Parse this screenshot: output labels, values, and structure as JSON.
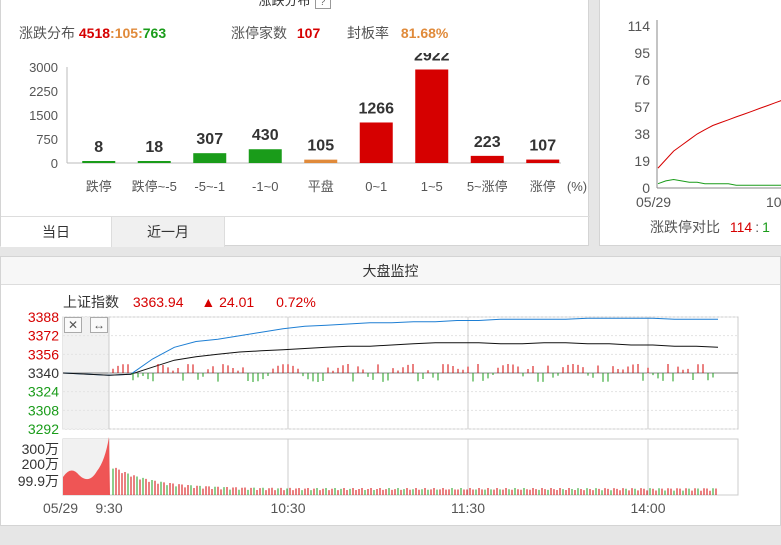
{
  "distribution": {
    "title": "涨跌分布",
    "help_icon": "?",
    "up_down_label": "涨跌分布",
    "up_count": "4518",
    "sep": ":",
    "flat_count": "105",
    "down_count": "763",
    "limit_up_label": "涨停家数",
    "limit_up_count": "107",
    "seal_rate_label": "封板率",
    "seal_rate": "81.68%",
    "unit": "(%)"
  },
  "tabs": {
    "today": "当日",
    "month": "近一月"
  },
  "chart_data": [
    {
      "type": "bar",
      "categories": [
        "跌停",
        "跌停~-5",
        "-5~-1",
        "-1~0",
        "平盘",
        "0~1",
        "1~5",
        "5~涨停",
        "涨停"
      ],
      "values": [
        8,
        18,
        307,
        430,
        105,
        1266,
        2922,
        223,
        107
      ],
      "colors": [
        "#1a9c1a",
        "#1a9c1a",
        "#1a9c1a",
        "#1a9c1a",
        "#e08a3a",
        "#d60000",
        "#d60000",
        "#d60000",
        "#d60000"
      ],
      "yticks": [
        "3000",
        "2250",
        "1500",
        "750",
        "0"
      ],
      "ylim": [
        0,
        3000
      ],
      "xlabel": "(%)"
    },
    {
      "type": "line",
      "yticks": [
        "114",
        "95",
        "76",
        "57",
        "38",
        "19",
        "0"
      ],
      "ylim": [
        0,
        114
      ],
      "xticks": [
        "05/29",
        "10"
      ],
      "series": [
        {
          "color": "#d60000",
          "values": [
            14,
            20,
            26,
            30,
            34,
            38,
            41,
            44,
            46,
            48,
            50,
            52,
            54,
            56,
            58,
            60,
            62,
            64
          ]
        },
        {
          "color": "#1a9c1a",
          "values": [
            3,
            5,
            6,
            5,
            4,
            4,
            3,
            3,
            3,
            3,
            2,
            2,
            2,
            2,
            2,
            2,
            2,
            2
          ]
        }
      ],
      "legend_label": "涨跌停对比",
      "legend_up": "114",
      "legend_sep": ":",
      "legend_down": "1"
    },
    {
      "type": "line",
      "yticks": [
        "3388",
        "3372",
        "3356",
        "3340",
        "3324",
        "3308",
        "3292"
      ],
      "ylim": [
        3292,
        3388
      ],
      "xticks": [
        "05/29",
        "9:30",
        "10:30",
        "11:30",
        "14:00"
      ],
      "series": [
        {
          "color": "#1e7fd4",
          "values": [
            3340,
            3338,
            3339,
            3352,
            3362,
            3367,
            3369,
            3372,
            3375,
            3378,
            3380,
            3381,
            3382,
            3383,
            3383,
            3384,
            3384,
            3385,
            3385,
            3386,
            3386,
            3386,
            3386,
            3387,
            3387,
            3387,
            3387,
            3386,
            3386,
            3386
          ]
        },
        {
          "color": "#111111",
          "values": [
            3340,
            3338,
            3339,
            3345,
            3351,
            3354,
            3356,
            3358,
            3359,
            3360,
            3361,
            3362,
            3363,
            3363,
            3364,
            3365,
            3366,
            3366,
            3366,
            3365,
            3365,
            3366,
            3366,
            3365,
            3365,
            3364,
            3364,
            3363,
            3363,
            3362
          ]
        }
      ],
      "volume_yticks": [
        "300万",
        "200万",
        "99.9万"
      ]
    }
  ],
  "market": {
    "header": "大盘监控",
    "index_name": "上证指数",
    "index_value": "3363.94",
    "change_arrow": "▲",
    "change": "24.01",
    "change_pct": "0.72%",
    "close_icon": "✕",
    "expand_icon": "↔"
  }
}
